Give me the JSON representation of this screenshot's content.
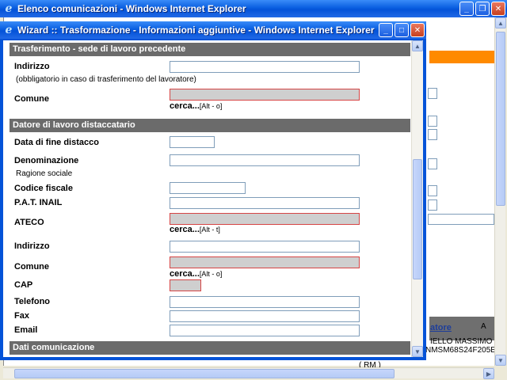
{
  "bg_window": {
    "title": "Elenco comunicazioni - Windows Internet Explorer",
    "link": "atore",
    "text1": "IELLO MASSIMO",
    "text2": "NMSM68S24F205E",
    "text3": "( RM )",
    "text4": "A"
  },
  "popup": {
    "title": "Wizard :: Trasformazione - Informazioni aggiuntive - Windows Internet Explorer"
  },
  "sections": {
    "trasferimento": "Trasferimento - sede di lavoro precedente",
    "datore": "Datore di lavoro distaccatario",
    "dati": "Dati comunicazione"
  },
  "fields": {
    "indirizzo1": "Indirizzo",
    "indirizzo1_note": "(obbligatorio in caso di trasferimento del lavoratore)",
    "comune1": "Comune",
    "cerca1": "cerca...",
    "cerca1_key": "[Alt - o]",
    "data_fine": "Data di fine distacco",
    "denominazione": "Denominazione",
    "ragione_sociale": "Ragione sociale",
    "codice_fiscale": "Codice fiscale",
    "pat_inail": "P.A.T. INAIL",
    "ateco": "ATECO",
    "cerca_ateco": "cerca...",
    "cerca_ateco_key": "[Alt - t]",
    "indirizzo2": "Indirizzo",
    "comune2": "Comune",
    "cerca2": "cerca...",
    "cerca2_key": "[Alt - o]",
    "cap": "CAP",
    "telefono": "Telefono",
    "fax": "Fax",
    "email": "Email"
  },
  "colors": {
    "xp_title_blue": "#0453d8",
    "section_gray": "#6b6b6b",
    "required_border": "#d64545",
    "accent_orange": "#ff8a00"
  }
}
